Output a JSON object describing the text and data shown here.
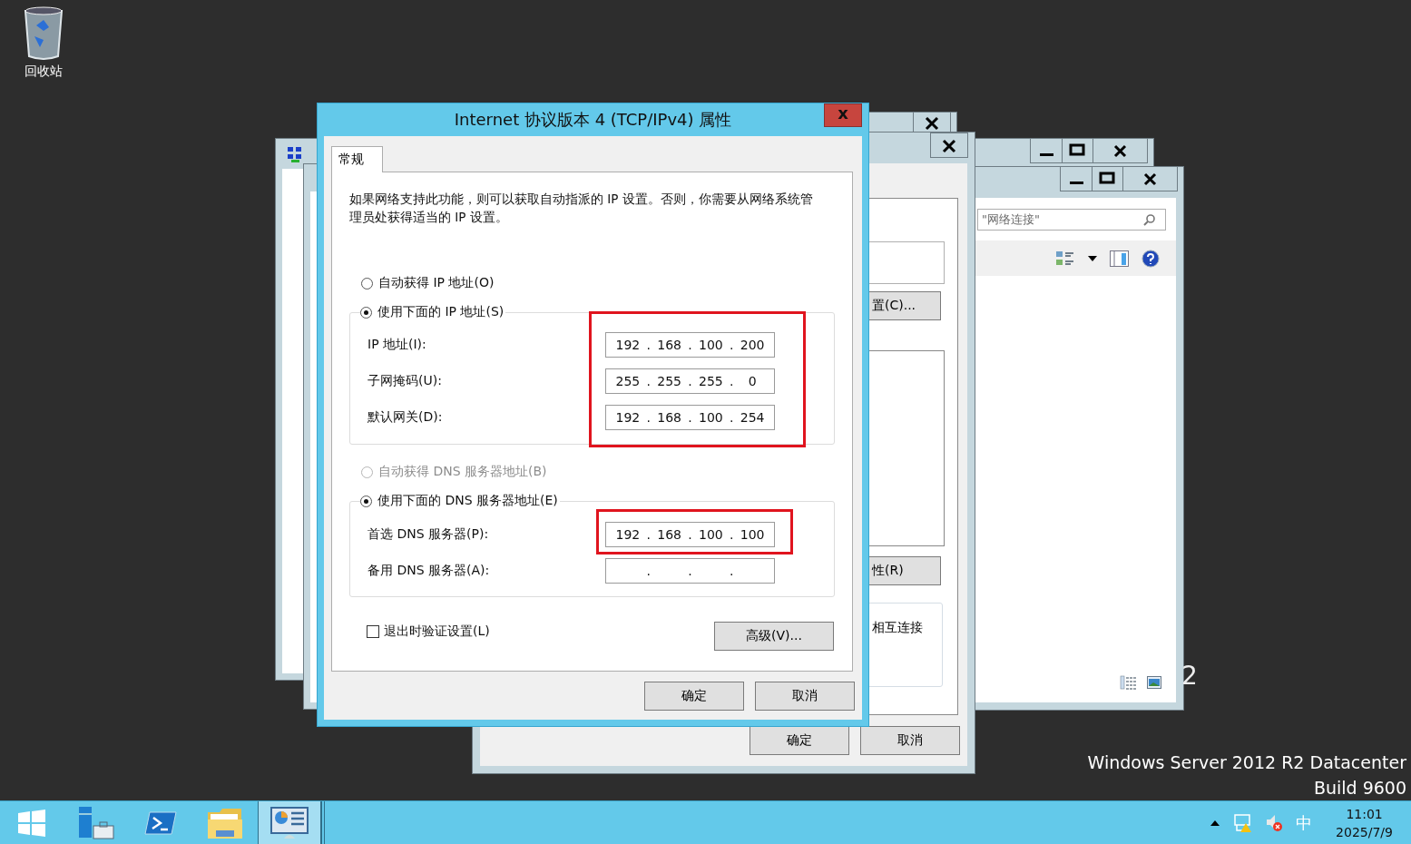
{
  "desktop": {
    "icons": [
      {
        "label": "回收站"
      }
    ],
    "edition_lines": [
      "Windows Server 2012 R2 Datacenter",
      "Build 9600"
    ],
    "fragment": "2"
  },
  "adapter_window": {
    "buttons": [
      {
        "label": "置(C)..."
      },
      {
        "label": "性(R)"
      }
    ],
    "group_text": "相互连接",
    "footer_buttons": [
      "确定",
      "取消"
    ]
  },
  "connections_window": {
    "search_text": "\"网络连接\""
  },
  "dialog": {
    "title": "Internet 协议版本 4 (TCP/IPv4) 属性",
    "close_label": "x",
    "tabs": [
      {
        "label": "常规",
        "selected": true
      }
    ],
    "description": "如果网络支持此功能，则可以获取自动指派的 IP 设置。否则，你需要从网络系统管理员处获得适当的 IP 设置。",
    "separator": ".",
    "ip_options": [
      {
        "label": "自动获得 IP 地址(O)",
        "selected": false,
        "disabled": false
      },
      {
        "label": "使用下面的 IP 地址(S)",
        "selected": true,
        "disabled": false
      }
    ],
    "ip_fields": [
      {
        "label": "IP 地址(I):",
        "octets": [
          "192",
          "168",
          "100",
          "200"
        ]
      },
      {
        "label": "子网掩码(U):",
        "octets": [
          "255",
          "255",
          "255",
          "0"
        ]
      },
      {
        "label": "默认网关(D):",
        "octets": [
          "192",
          "168",
          "100",
          "254"
        ]
      }
    ],
    "ip_highlighted": true,
    "dns_options": [
      {
        "label": "自动获得 DNS 服务器地址(B)",
        "selected": false,
        "disabled": true
      },
      {
        "label": "使用下面的 DNS 服务器地址(E)",
        "selected": true,
        "disabled": false
      }
    ],
    "dns_fields": [
      {
        "label": "首选 DNS 服务器(P):",
        "octets": [
          "192",
          "168",
          "100",
          "100"
        ],
        "highlighted": true
      },
      {
        "label": "备用 DNS 服务器(A):",
        "highlighted": false
      }
    ],
    "validate_checkbox": {
      "label": "退出时验证设置(L)",
      "checked": false
    },
    "advanced_button": "高级(V)...",
    "buttons": [
      "确定",
      "取消"
    ]
  },
  "taskbar": {
    "apps": [
      {
        "kind": "start",
        "active": false
      },
      {
        "kind": "server-manager",
        "active": false
      },
      {
        "kind": "powershell",
        "active": false
      },
      {
        "kind": "explorer",
        "active": false
      },
      {
        "kind": "network",
        "active": true
      }
    ],
    "tray": {
      "ime": "中",
      "time": "11:01",
      "date": "2025/7/9"
    }
  }
}
